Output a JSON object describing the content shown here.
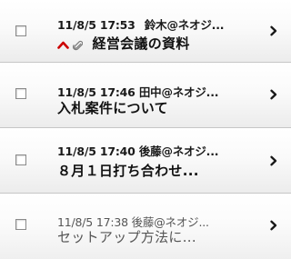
{
  "messages": [
    {
      "date": "11/8/5",
      "time": "17:53",
      "sender": "鈴木@ネオジ...",
      "subject": "経営会議の資料",
      "important": true,
      "attachment": true,
      "unread": true,
      "checked": false
    },
    {
      "date": "11/8/5",
      "time": "17:46",
      "sender": "田中@ネオジ...",
      "subject": "入札案件について",
      "important": false,
      "attachment": false,
      "unread": true,
      "checked": false
    },
    {
      "date": "11/8/5",
      "time": "17:40",
      "sender": "後藤@ネオジ...",
      "subject": "８月１日打ち合わせ...",
      "important": false,
      "attachment": false,
      "unread": true,
      "checked": false
    },
    {
      "date": "11/8/5",
      "time": "17:38",
      "sender": "後藤@ネオジ...",
      "subject": "セットアップ方法に...",
      "important": false,
      "attachment": false,
      "unread": false,
      "checked": false
    }
  ],
  "colors": {
    "important": "#cc0000",
    "attachment": "#7a7a7a"
  },
  "icons": {
    "important": "up-caret-icon",
    "attachment": "paperclip-icon",
    "open": "chevron-right-icon"
  }
}
